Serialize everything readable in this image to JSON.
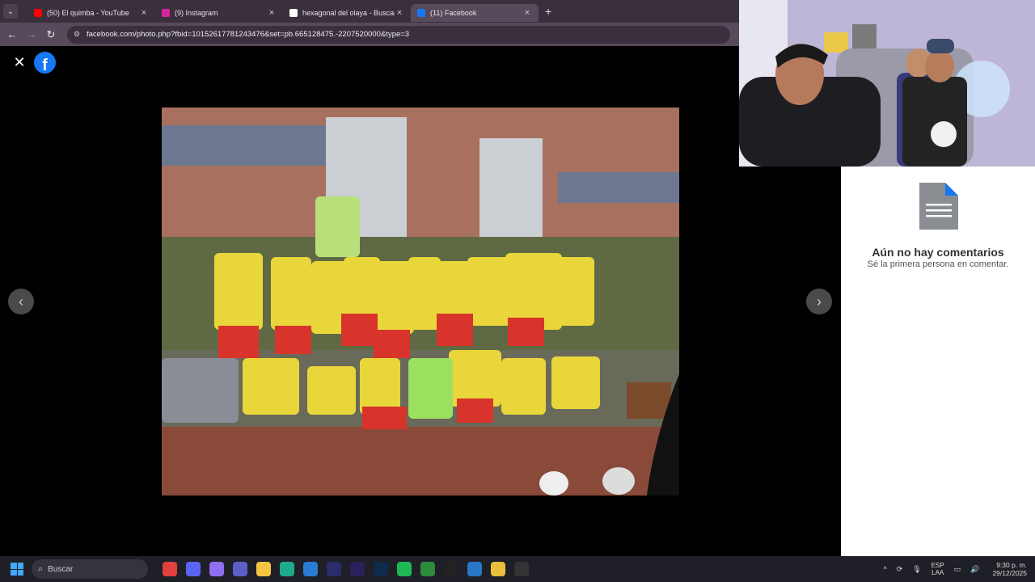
{
  "browser": {
    "tabs": [
      {
        "title": "(50) El quimba - YouTube",
        "icon": "youtube-icon",
        "color": "#ff0000",
        "active": false
      },
      {
        "title": "(9) Instagram",
        "icon": "instagram-icon",
        "color": "#d6249f",
        "active": false
      },
      {
        "title": "hexagonal del olaya - Buscar co",
        "icon": "google-icon",
        "color": "#ffffff",
        "active": false
      },
      {
        "title": "(11) Facebook",
        "icon": "facebook-icon",
        "color": "#1877f2",
        "active": true
      }
    ],
    "url": "facebook.com/photo.php?fbid=10152617781243476&set=pb.665128475.-2207520000&type=3"
  },
  "viewer": {
    "close_symbol": "✕",
    "logo_letter": "f",
    "prev_symbol": "‹",
    "next_symbol": "›"
  },
  "comments": {
    "empty_title": "Aún no hay comentarios",
    "empty_subtitle": "Sé la primera persona en comentar."
  },
  "taskbar": {
    "search_placeholder": "Buscar",
    "apps": [
      {
        "icon": "video-app-icon",
        "color": "#e0413c"
      },
      {
        "icon": "discord-icon",
        "color": "#5865f2"
      },
      {
        "icon": "copilot-icon",
        "color": "#8f6ef0"
      },
      {
        "icon": "teams-icon",
        "color": "#5b5fc7"
      },
      {
        "icon": "file-explorer-icon",
        "color": "#f5c542"
      },
      {
        "icon": "edge-icon",
        "color": "#1faa8c"
      },
      {
        "icon": "store-icon",
        "color": "#2a7bd4"
      },
      {
        "icon": "after-effects-icon",
        "color": "#2b2b6e"
      },
      {
        "icon": "premiere-icon",
        "color": "#2b1f5c"
      },
      {
        "icon": "photoshop-icon",
        "color": "#0f2a4a"
      },
      {
        "icon": "spotify-icon",
        "color": "#1db954"
      },
      {
        "icon": "xbox-icon",
        "color": "#2e8b3a"
      },
      {
        "icon": "capcut-icon",
        "color": "#222222"
      },
      {
        "icon": "app-icon",
        "color": "#2878c8"
      },
      {
        "icon": "chrome-icon",
        "color": "#e8c03a"
      },
      {
        "icon": "obs-icon",
        "color": "#333333"
      }
    ],
    "language": "ESP",
    "region": "LAA",
    "time": "9:30 p. m.",
    "date": "29/12/2025"
  }
}
